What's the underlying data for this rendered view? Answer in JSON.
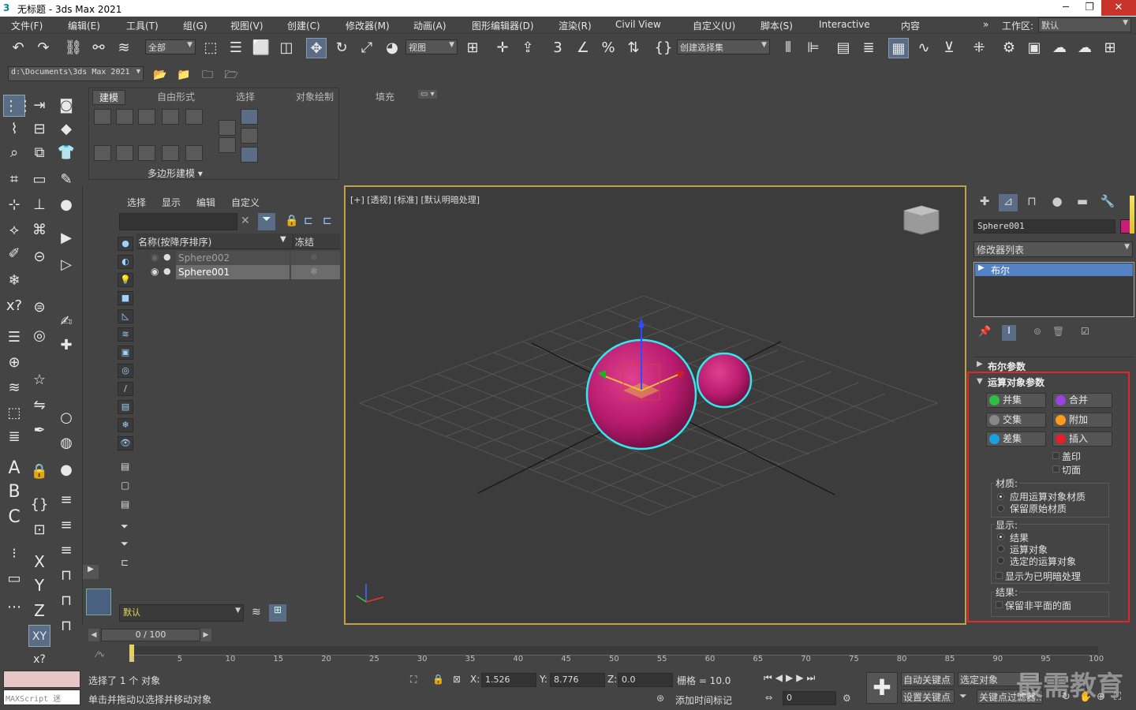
{
  "window": {
    "title": "无标题 - 3ds Max 2021",
    "min": "─",
    "max": "❐",
    "close": "✕"
  },
  "menu": [
    "文件(F)",
    "编辑(E)",
    "工具(T)",
    "组(G)",
    "视图(V)",
    "创建(C)",
    "修改器(M)",
    "动画(A)",
    "图形编辑器(D)",
    "渲染(R)",
    "Civil View",
    "自定义(U)",
    "脚本(S)",
    "Interactive",
    "内容"
  ],
  "workspace": {
    "label": "工作区:",
    "value": "默认"
  },
  "toolbar": {
    "filter_value": "全部",
    "refcoord_value": "视图",
    "selection_set": "创建选择集"
  },
  "toolbar2": {
    "path": "d:\\Documents\\3ds Max 2021"
  },
  "ribbon": {
    "tabs": [
      "建模",
      "自由形式",
      "选择",
      "对象绘制",
      "填充"
    ],
    "panel_label": "多边形建模 ▾"
  },
  "explorer": {
    "menus": [
      "选择",
      "显示",
      "编辑",
      "自定义"
    ],
    "col_name": "名称(按降序排序)",
    "col_freeze": "冻结",
    "rows": [
      {
        "name": "Sphere002",
        "selected": false
      },
      {
        "name": "Sphere001",
        "selected": true
      }
    ],
    "layer": "默认"
  },
  "viewport": {
    "label": "[+] [透视] [标准] [默认明暗处理]"
  },
  "cmdpanel": {
    "object_name": "Sphere001",
    "object_color": "#c81e7a",
    "modifier_list": "修改器列表",
    "stack_item": "布尔",
    "rollout1": "布尔参数",
    "rollout2": "运算对象参数",
    "ops": [
      {
        "label": "并集",
        "color": "#2fbf40"
      },
      {
        "label": "合并",
        "color": "#9a44e0"
      },
      {
        "label": "交集",
        "color": "#888888"
      },
      {
        "label": "附加",
        "color": "#ff9a1a"
      },
      {
        "label": "差集",
        "color": "#1aa0e0"
      },
      {
        "label": "插入",
        "color": "#e0202a"
      }
    ],
    "imprint": "盖印",
    "cut": "切面",
    "material_title": "材质:",
    "material_opts": [
      "应用运算对象材质",
      "保留原始材质"
    ],
    "display_title": "显示:",
    "display_opts": [
      "结果",
      "运算对象",
      "选定的运算对象"
    ],
    "show_hidden": "显示为已明暗处理",
    "result_title": "结果:",
    "keep_nonplanar": "保留非平面的面"
  },
  "timeline": {
    "frame": "0 / 100",
    "ticks": [
      "0",
      "5",
      "10",
      "15",
      "20",
      "25",
      "30",
      "35",
      "40",
      "45",
      "50",
      "55",
      "60",
      "65",
      "70",
      "75",
      "80",
      "85",
      "90",
      "95",
      "100"
    ]
  },
  "status": {
    "maxscript": "MAXScript 迷",
    "selected": "选择了 1 个 对象",
    "hint": "单击并拖动以选择并移动对象",
    "x_label": "X:",
    "x": "1.526",
    "y_label": "Y:",
    "y": "8.776",
    "z_label": "Z:",
    "z": "0.0",
    "grid": "栅格 = 10.0",
    "add_tag": "添加时间标记",
    "auto_key": "自动关键点",
    "set_key": "设置关键点",
    "selected_obj": "选定对象",
    "key_filter": "关键点过滤器...",
    "frame_field": "0",
    "watermark": "最需教育"
  }
}
